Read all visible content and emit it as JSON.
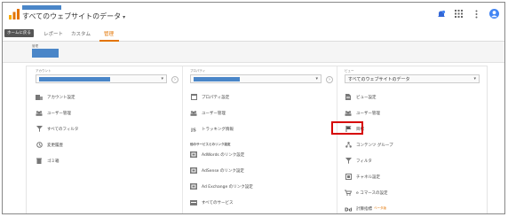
{
  "header": {
    "property_title": "すべてのウェブサイトのデータ",
    "caret": "▾"
  },
  "nav": {
    "home_label": "ホームに戻る",
    "tabs": [
      {
        "label": "レポート",
        "active": false
      },
      {
        "label": "カスタム",
        "active": false
      },
      {
        "label": "管理",
        "active": true
      }
    ]
  },
  "account_area": {
    "label": "管理"
  },
  "columns": {
    "account": {
      "label": "アカウント",
      "items": [
        {
          "label": "アカウント設定",
          "icon": "building-icon"
        },
        {
          "label": "ユーザー管理",
          "icon": "users-icon"
        },
        {
          "label": "すべてのフィルタ",
          "icon": "filter-icon"
        },
        {
          "label": "変更履歴",
          "icon": "history-icon"
        },
        {
          "label": "ゴミ箱",
          "icon": "trash-icon"
        }
      ]
    },
    "property": {
      "label": "プロパティ",
      "items": [
        {
          "label": "プロパティ設定",
          "icon": "window-icon"
        },
        {
          "label": "ユーザー管理",
          "icon": "users-icon"
        },
        {
          "label": "トラッキング情報",
          "icon": "js-icon"
        }
      ],
      "section_title": "他のサービスとのリンク設定",
      "link_items": [
        {
          "label": "AdWords のリンク設定",
          "icon": "adwords-icon"
        },
        {
          "label": "AdSense のリンク設定",
          "icon": "adsense-icon"
        },
        {
          "label": "Ad Exchange のリンク設定",
          "icon": "adexchange-icon"
        },
        {
          "label": "すべてのサービス",
          "icon": "services-icon"
        }
      ]
    },
    "view": {
      "label": "ビュー",
      "selected": "すべてのウェブサイトのデータ",
      "items": [
        {
          "label": "ビュー設定",
          "icon": "document-icon"
        },
        {
          "label": "ユーザー管理",
          "icon": "users-icon"
        },
        {
          "label": "目標",
          "icon": "flag-icon"
        },
        {
          "label": "コンテンツ グループ",
          "icon": "content-group-icon"
        },
        {
          "label": "フィルタ",
          "icon": "filter-icon"
        },
        {
          "label": "チャネル設定",
          "icon": "channel-icon"
        },
        {
          "label": "e コマースの設定",
          "icon": "cart-icon"
        },
        {
          "label": "計算指標",
          "icon": "dd-icon",
          "badge": "ベータ版"
        }
      ]
    }
  },
  "colors": {
    "accent": "#e37400",
    "brand_blue": "#4a86c8",
    "highlight": "#d60000"
  }
}
